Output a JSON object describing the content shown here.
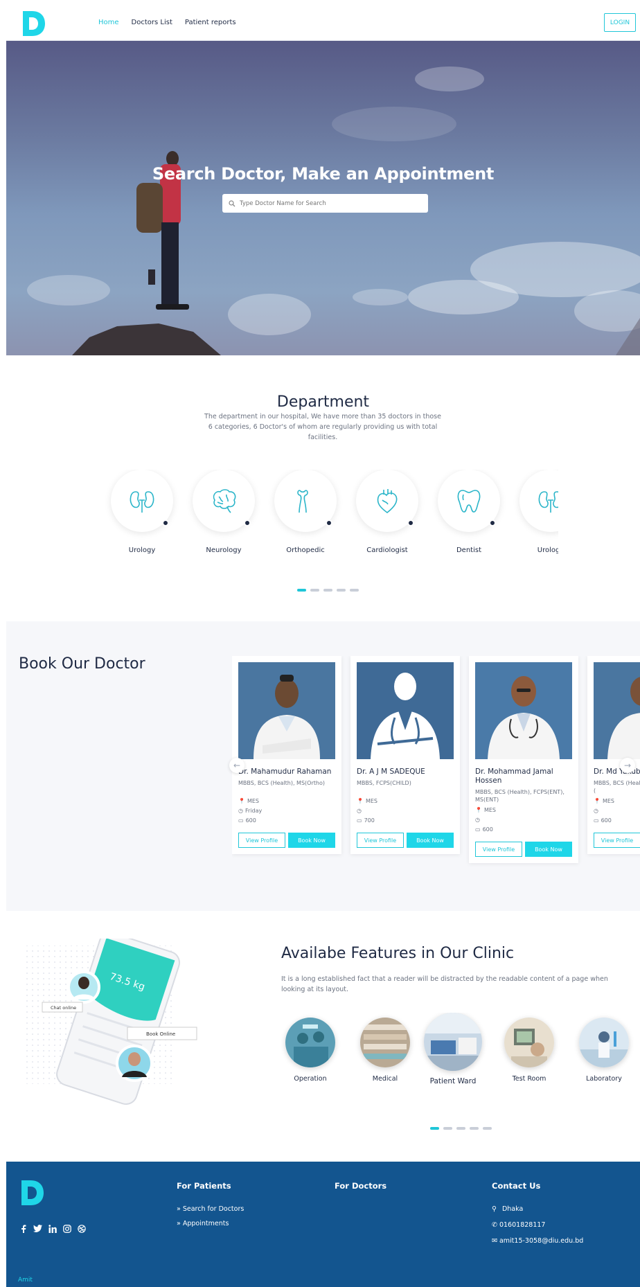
{
  "brand": {
    "accent": "#1fc6d8",
    "accent_fill": "#1fd6e8",
    "dark": "#1f2a44",
    "footer_bg": "#13558f"
  },
  "nav": {
    "logo_letter": "D",
    "links": [
      {
        "label": "Home",
        "active": true
      },
      {
        "label": "Doctors List",
        "active": false
      },
      {
        "label": "Patient reports",
        "active": false
      }
    ],
    "login_label": "LOGIN"
  },
  "hero": {
    "title": "Search Doctor, Make an Appointment",
    "search_placeholder": "Type Doctor Name for Search",
    "search_icon": "search-icon"
  },
  "department": {
    "title": "Department",
    "description": "The department in our hospital, We have more than 35 doctors in those 6 categories, 6 Doctor's of whom are regularly providing us with total facilities.",
    "items": [
      {
        "label": "Urology",
        "icon": "kidney-icon"
      },
      {
        "label": "Neurology",
        "icon": "brain-icon"
      },
      {
        "label": "Orthopedic",
        "icon": "bone-icon"
      },
      {
        "label": "Cardiologist",
        "icon": "heart-icon"
      },
      {
        "label": "Dentist",
        "icon": "tooth-icon"
      },
      {
        "label": "Urology",
        "icon": "kidney-icon"
      }
    ],
    "pager_active": 0
  },
  "book": {
    "title": "Book Our Doctor",
    "view_label": "View Profile",
    "book_label": "Book Now",
    "doctors": [
      {
        "name": "Dr. Mahamudur Rahaman",
        "degrees": "MBBS, BCS (Health), MS(Ortho)",
        "location": "MES",
        "day": "Friday",
        "fee": "600"
      },
      {
        "name": "Dr. A J M SADEQUE",
        "degrees": "MBBS, FCPS(CHILD)",
        "location": "MES",
        "day": "",
        "fee": "700"
      },
      {
        "name": "Dr. Mohammad Jamal Hossen",
        "degrees": "MBBS, BCS (Health), FCPS(ENT), MS(ENT)",
        "location": "MES",
        "day": "",
        "fee": "600"
      },
      {
        "name": "Dr. Md Yakub",
        "degrees": "MBBS, BCS (Health), (Surgery), MS (",
        "location": "MES",
        "day": "",
        "fee": "600"
      }
    ]
  },
  "features": {
    "title": "Availabe Features in Our Clinic",
    "description": "It is a long established fact that a reader will be distracted by the readable content of a page when looking at its layout.",
    "phone": {
      "chat_label": "Chat online",
      "book_label": "Book Online",
      "weight": "73.5 kg"
    },
    "items": [
      {
        "label": "Operation"
      },
      {
        "label": "Medical"
      },
      {
        "label": "Patient Ward"
      },
      {
        "label": "Test Room"
      },
      {
        "label": "Laboratory"
      }
    ],
    "pager_active": 0
  },
  "footer": {
    "patients_title": "For Patients",
    "patients_links": [
      "Search for Doctors",
      "Appointments"
    ],
    "doctors_title": "For Doctors",
    "contact_title": "Contact Us",
    "contact": {
      "city": "Dhaka",
      "phone": "01601828117",
      "email": "amit15-3058@diu.edu.bd"
    },
    "social_icons": [
      "facebook-icon",
      "twitter-icon",
      "linkedin-icon",
      "instagram-icon",
      "dribbble-icon"
    ],
    "copyright": "Amit"
  }
}
